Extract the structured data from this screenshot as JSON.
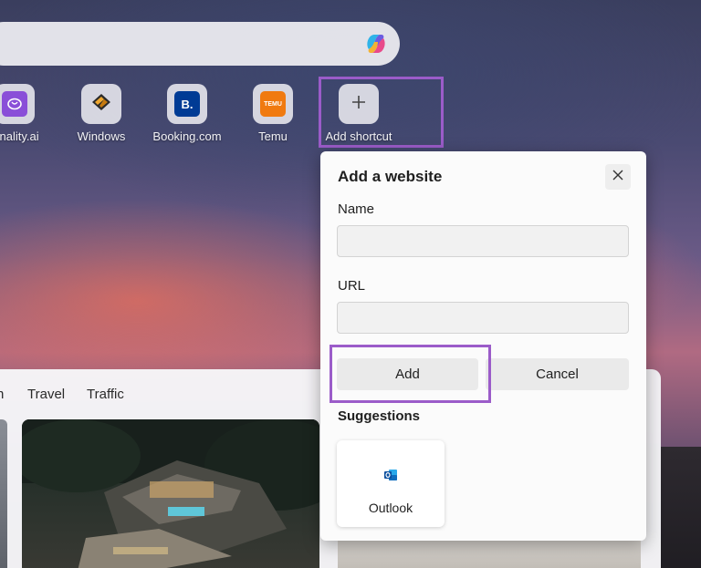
{
  "shortcuts": [
    {
      "label": "ginality.ai",
      "icon": "brain-icon",
      "color": "#8a4fd8"
    },
    {
      "label": "Windows",
      "icon": "windows-logo-icon",
      "color": "#e0a020"
    },
    {
      "label": "Booking.com",
      "icon": "booking-logo-icon",
      "tile_text": "B.",
      "color": "#003b95"
    },
    {
      "label": "Temu",
      "icon": "temu-logo-icon",
      "tile_text": "TEMU",
      "color": "#f07a10"
    },
    {
      "label": "Add shortcut",
      "icon": "plus-icon"
    }
  ],
  "news": {
    "tabs": [
      "n",
      "Travel",
      "Traffic"
    ]
  },
  "dialog": {
    "title": "Add a website",
    "name_label": "Name",
    "name_value": "",
    "url_label": "URL",
    "url_value": "",
    "add_label": "Add",
    "cancel_label": "Cancel",
    "suggestions_title": "Suggestions",
    "suggestions": [
      {
        "label": "Outlook",
        "icon": "outlook-icon",
        "color": "#0f6cbd"
      }
    ]
  },
  "colors": {
    "highlight": "#9b5cc9"
  }
}
